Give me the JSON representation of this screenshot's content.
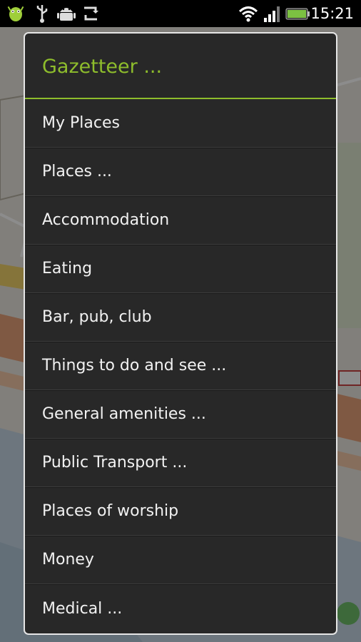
{
  "status_bar": {
    "time": "15:21",
    "left_icons": [
      "android-bug-icon",
      "usb-icon",
      "android-debug-icon",
      "sync-icon"
    ],
    "right_icons": [
      "wifi-icon",
      "signal-icon",
      "battery-icon"
    ],
    "battery_color": "#7cc142"
  },
  "dialog": {
    "title": "Gazetteer ...",
    "accent_color": "#8ebd2c",
    "items": [
      {
        "label": "My Places"
      },
      {
        "label": "Places ..."
      },
      {
        "label": "Accommodation"
      },
      {
        "label": "Eating"
      },
      {
        "label": "Bar, pub, club"
      },
      {
        "label": "Things to do and see ..."
      },
      {
        "label": "General amenities ..."
      },
      {
        "label": "Public Transport ..."
      },
      {
        "label": "Places of worship"
      },
      {
        "label": "Money"
      },
      {
        "label": "Medical ..."
      }
    ]
  }
}
